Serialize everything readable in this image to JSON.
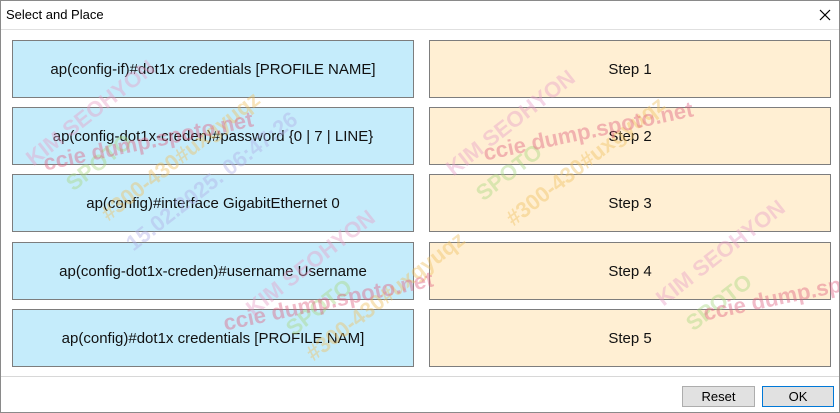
{
  "window": {
    "title": "Select and Place",
    "close_icon": "close-icon"
  },
  "sources": [
    {
      "label": "ap(config-if)#dot1x credentials [PROFILE NAME]"
    },
    {
      "label": "ap(config-dot1x-creden)#password {0 | 7 | LINE}"
    },
    {
      "label": "ap(config)#interface GigabitEthernet 0"
    },
    {
      "label": "ap(config-dot1x-creden)#username Username"
    },
    {
      "label": "ap(config)#dot1x credentials [PROFILE NAM]"
    }
  ],
  "targets": [
    {
      "label": "Step 1"
    },
    {
      "label": "Step 2"
    },
    {
      "label": "Step 3"
    },
    {
      "label": "Step 4"
    },
    {
      "label": "Step 5"
    }
  ],
  "buttons": {
    "reset": "Reset",
    "ok": "OK"
  },
  "colors": {
    "source_bg": "#c5ecfb",
    "target_bg": "#ffefd3",
    "ok_border": "#0078d7"
  },
  "watermark": {
    "lines": [
      "KIM SEOHYON",
      "SPOTO",
      "#300-430#uxgyuqz",
      "15.02.2025. 06:47:26",
      "ccie dump.spoto.net"
    ]
  }
}
